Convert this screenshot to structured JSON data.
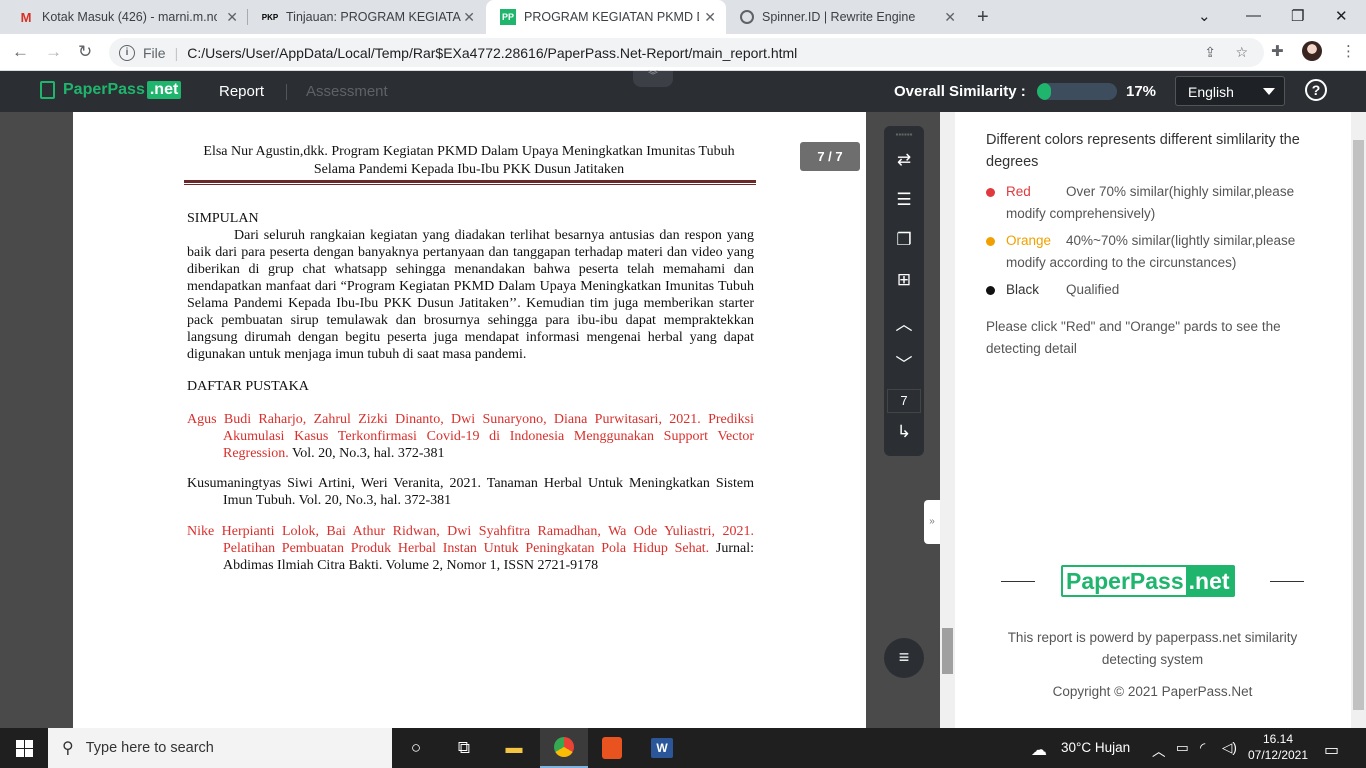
{
  "browser": {
    "tabs": [
      {
        "title": "Kotak Masuk (426) - marni.m.noc",
        "favicon": "M"
      },
      {
        "title": "Tinjauan: PROGRAM KEGIATAN P",
        "favicon": "PKP"
      },
      {
        "title": "PROGRAM KEGIATAN PKMD DAL",
        "favicon": "PP"
      },
      {
        "title": "Spinner.ID | Rewrite Engine",
        "favicon": "globe-icon"
      }
    ],
    "file_label": "File",
    "url": "C:/Users/User/AppData/Local/Temp/Rar$EXa4772.28616/PaperPass.Net-Report/main_report.html"
  },
  "app": {
    "logo_main": "PaperPass",
    "logo_net": ".net",
    "nav_report": "Report",
    "nav_assessment": "Assessment",
    "overall_label": "Overall Similarity :",
    "similarity_value": 0.17,
    "similarity_text": "17%",
    "language": "English",
    "help": "?",
    "accent": "#1fb56d"
  },
  "document": {
    "page_badge": "7 / 7",
    "header_line1": "Elsa Nur Agustin,dkk.  Program Kegiatan PKMD Dalam Upaya Meningkatkan Imunitas Tubuh",
    "header_line2": "Selama Pandemi Kepada Ibu-Ibu PKK Dusun Jatitaken",
    "simpulan_heading": "SIMPULAN",
    "simpulan_body": "Dari seluruh rangkaian kegiatan yang diadakan terlihat besarnya antusias dan respon yang baik dari para peserta dengan banyaknya pertanyaan dan tanggapan terhadap materi dan video yang diberikan di grup chat whatsapp sehingga menandakan bahwa peserta telah memahami dan mendapatkan manfaat dari “Program Kegiatan PKMD Dalam Upaya Meningkatkan Imunitas Tubuh Selama Pandemi Kepada Ibu-Ibu PKK Dusun Jatitaken’’. Kemudian tim juga memberikan starter pack pembuatan sirup temulawak dan brosurnya sehingga para ibu-ibu dapat mempraktekkan langsung dirumah dengan begitu peserta juga mendapat informasi mengenai herbal yang dapat digunakan untuk menjaga imun tubuh di saat masa pandemi.",
    "pustaka_heading": "DAFTAR PUSTAKA",
    "ref1_red": "Agus Budi Raharjo, Zahrul Zizki Dinanto, Dwi Sunaryono, Diana Purwitasari, 2021. Prediksi Akumulasi Kasus Terkonfirmasi Covid-19 di Indonesia Menggunakan Support Vector Regression.",
    "ref1_black": " Vol. 20, No.3, hal. 372-381",
    "ref2": "Kusumaningtyas Siwi Artini, Weri Veranita, 2021. Tanaman Herbal Untuk Meningkatkan Sistem Imun Tubuh. Vol. 20, No.3, hal. 372-381",
    "ref3_red": "Nike Herpianti Lolok, Bai Athur Ridwan, Dwi Syahfitra Ramadhan, Wa Ode Yuliastri, 2021. Pelatihan Pembuatan Produk Herbal Instan Untuk Peningkatan Pola Hidup Sehat.",
    "ref3_black": " Jurnal: Abdimas Ilmiah Citra Bakti. Volume 2, Nomor 1, ISSN 2721-9178",
    "highlight_color": "#d9302c"
  },
  "toolbar": {
    "page_number": "7"
  },
  "panel": {
    "title": "Different colors represents different simlilarity the degrees",
    "legend": [
      {
        "name": "Red",
        "desc": "Over 70% similar(highly similar,please modify comprehensively)",
        "color": "#e0393e"
      },
      {
        "name": "Orange",
        "desc": "40%~70% similar(lightly similar,please modify according to the circunstances)",
        "color": "#f0a000"
      },
      {
        "name": "Black",
        "desc": "Qualified",
        "color": "#111111"
      }
    ],
    "note": "Please click \"Red\" and \"Orange\" pards to see the detecting detail",
    "logo_main": "PaperPass",
    "logo_net": ".net",
    "footer": "This report is powerd by paperpass.net similarity detecting system",
    "copyright": "Copyright © 2021 PaperPass.Net"
  },
  "taskbar": {
    "search_placeholder": "Type here to search",
    "weather": "30°C  Hujan",
    "time": "16.14",
    "date": "07/12/2021"
  }
}
